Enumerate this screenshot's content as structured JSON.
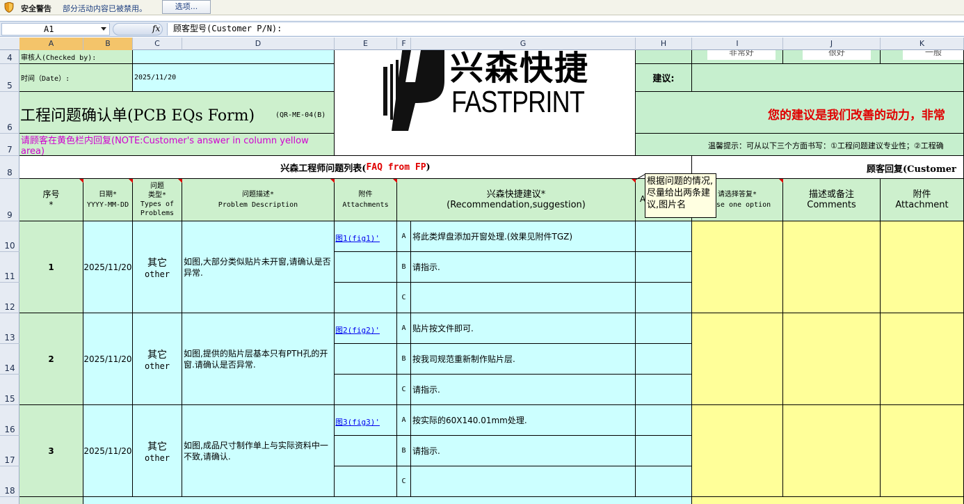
{
  "security": {
    "title": "安全警告",
    "message": "部分活动内容已被禁用。",
    "options_button": "选项..."
  },
  "formula_bar": {
    "name_box": "A1",
    "fx": "fx",
    "formula": "顾客型号(Customer P/N):"
  },
  "columns": [
    "A",
    "B",
    "C",
    "D",
    "E",
    "F",
    "G",
    "H",
    "I",
    "J",
    "K"
  ],
  "rows": [
    "4",
    "5",
    "6",
    "7",
    "8",
    "9",
    "10",
    "11",
    "12",
    "13",
    "14",
    "15",
    "16",
    "17",
    "18"
  ],
  "header": {
    "checked_by": "审核人(Checked by):",
    "date_label": "时间（Date）:",
    "date_value": "2025/11/20",
    "form_title": "工程问题确认单(PCB EQs Form)",
    "form_code": "(QR-ME-04(B)",
    "yellow_note": "请顾客在黄色栏内回复(NOTE:Customer's answer in column yellow area)",
    "logo_cn": "兴森快捷",
    "logo_en": "FASTPRINT",
    "suggest_label": "建议:",
    "motto": "您的建议是我们改善的动力，非常",
    "tip": "温馨提示：可从以下三个方面书写：①工程问题建议专业性；②工程确",
    "row4_i": "非常好",
    "row4_j": "很好",
    "row4_k": "一般"
  },
  "section": {
    "fp_list_prefix": "兴森工程师问题列表(",
    "fp_list_faq": "FAQ from FP",
    "fp_list_suffix": ")",
    "customer_reply": "顾客回复(Customer"
  },
  "table_headers": {
    "no": "序号\n*",
    "date": "日期*\nYYYY-MM-DD",
    "type": "问题\n类型*\nTypes of\nProblems",
    "desc": "问题描述*\nProblem Description",
    "attach": "附件\nAttachments",
    "recommend": "兴森快捷建议*\n(Recommendation,suggestion)",
    "h_col": "A",
    "choose": "请选择答复*\nhoose one option",
    "comments": "描述或备注\nComments",
    "attachment": "附件\nAttachment"
  },
  "problems": [
    {
      "no": "1",
      "date": "2025/11/20",
      "type_cn": "其它",
      "type_en": "other",
      "desc": "如图,大部分类似贴片未开窗,请确认是否异常.",
      "attach": "图1(fig1)'",
      "options": [
        {
          "letter": "A",
          "text": "将此类焊盘添加开窗处理.(效果见附件TGZ)"
        },
        {
          "letter": "B",
          "text": "请指示."
        },
        {
          "letter": "C",
          "text": ""
        }
      ]
    },
    {
      "no": "2",
      "date": "2025/11/20",
      "type_cn": "其它",
      "type_en": "other",
      "desc": "如图,提供的贴片层基本只有PTH孔的开窗.请确认是否异常.",
      "attach": "图2(fig2)'",
      "options": [
        {
          "letter": "A",
          "text": "贴片按文件即可."
        },
        {
          "letter": "B",
          "text": "按我司规范重新制作贴片层."
        },
        {
          "letter": "C",
          "text": "请指示."
        }
      ]
    },
    {
      "no": "3",
      "date": "2025/11/20",
      "type_cn": "其它",
      "type_en": "other",
      "desc": "如图,成品尺寸制作单上与实际资料中一不致,请确认.",
      "attach": "图3(fig3)'",
      "options": [
        {
          "letter": "A",
          "text": "按实际的60X140.01mm处理."
        },
        {
          "letter": "B",
          "text": "请指示."
        },
        {
          "letter": "C",
          "text": ""
        }
      ]
    }
  ],
  "tooltip": "根据问题的情况,尽量给出两条建议,图片名",
  "colors": {
    "cyan": "#ccffff",
    "green": "#cdf0cd",
    "yellow": "#ffff99",
    "red": "#e00000",
    "magenta": "#d000d0"
  }
}
